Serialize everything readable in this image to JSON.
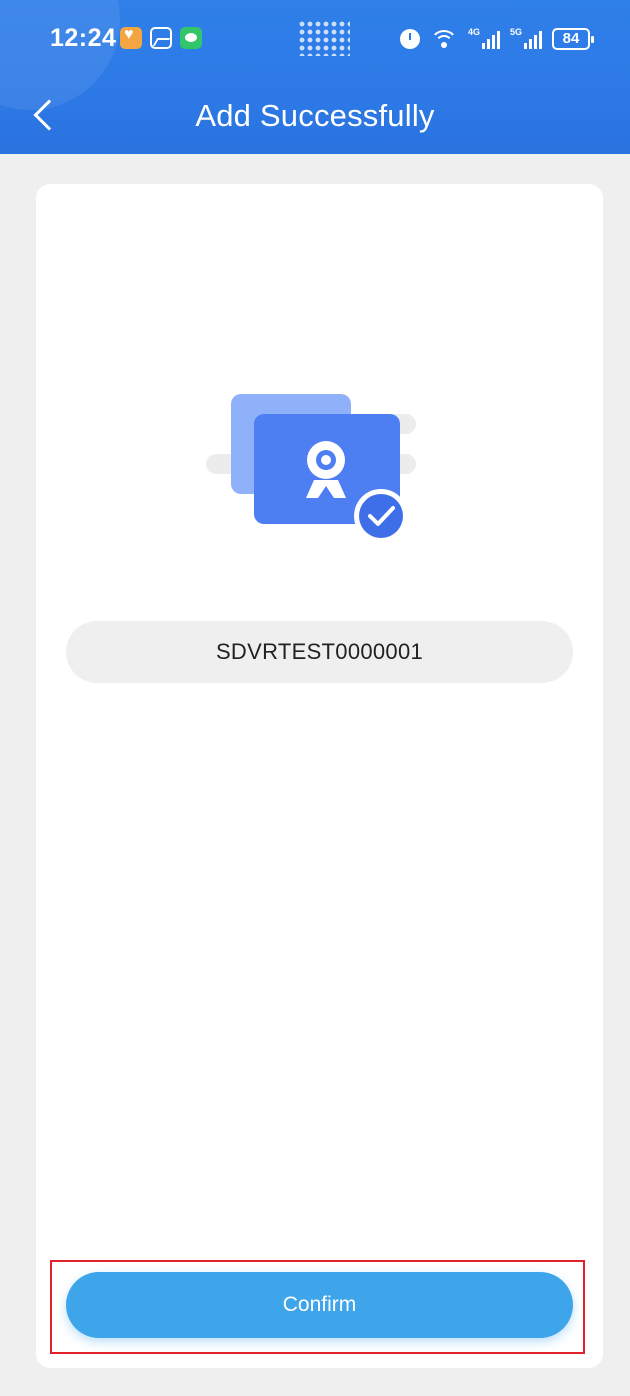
{
  "status_bar": {
    "time": "12:24",
    "signal1_label": "4G",
    "signal2_label": "5G",
    "battery": "84"
  },
  "header": {
    "title": "Add Successfully"
  },
  "device": {
    "id": "SDVRTEST0000001"
  },
  "actions": {
    "confirm_label": "Confirm"
  },
  "colors": {
    "header_blue": "#2d7ae6",
    "button_blue": "#3fa5ea",
    "highlight_red": "#e0222a",
    "background": "#efefef"
  }
}
